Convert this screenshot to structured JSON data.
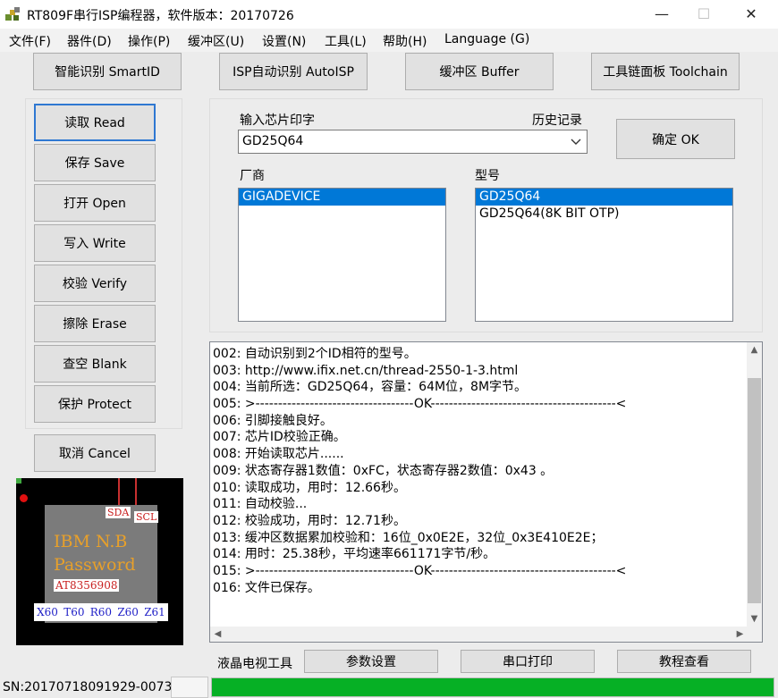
{
  "window": {
    "title": "RT809F串行ISP编程器，软件版本：20170726",
    "minimize_glyph": "—",
    "maximize_glyph": "☐",
    "close_glyph": "✕"
  },
  "menu": [
    "文件(F)",
    "器件(D)",
    "操作(P)",
    "缓冲区(U)",
    "设置(N)",
    "工具(L)",
    "帮助(H)",
    "Language (G)"
  ],
  "top_buttons": {
    "smartid": "智能识别 SmartID",
    "autoisp": "ISP自动识别 AutoISP",
    "buffer": "缓冲区 Buffer",
    "toolchain": "工具链面板 Toolchain"
  },
  "left_buttons": {
    "read": "读取 Read",
    "save": "保存 Save",
    "open": "打开 Open",
    "write": "写入 Write",
    "verify": "校验 Verify",
    "erase": "擦除 Erase",
    "blank": "查空 Blank",
    "protect": "保护 Protect",
    "cancel": "取消 Cancel"
  },
  "chip_search": {
    "input_label": "输入芯片印字",
    "history_label": "历史记录",
    "input_value": "GD25Q64",
    "confirm_label": "确定 OK"
  },
  "manufacturer": {
    "label": "厂商",
    "items": [
      "GIGADEVICE"
    ],
    "selected_index": 0
  },
  "model": {
    "label": "型号",
    "items": [
      "GD25Q64",
      "GD25Q64(8K BIT OTP)"
    ],
    "selected_index": 0
  },
  "log": [
    "002: 自动识别到2个ID相符的型号。",
    "003: http://www.ifix.net.cn/thread-2550-1-3.html",
    "004: 当前所选：GD25Q64，容量：64M位，8M字节。",
    "005: >-----------------------------------OK-----------------------------------------<",
    "006: 引脚接触良好。",
    "007: 芯片ID校验正确。",
    "008: 开始读取芯片......",
    "009: 状态寄存器1数值：0xFC，状态寄存器2数值：0x43 。",
    "010: 读取成功，用时：12.66秒。",
    "011: 自动校验...",
    "012: 校验成功，用时：12.71秒。",
    "013: 缓冲区数据累加校验和：16位_0x0E2E，32位_0x3E410E2E；",
    "014: 用时：25.38秒，平均速率661171字节/秒。",
    "015: >-----------------------------------OK-----------------------------------------<",
    "016: 文件已保存。"
  ],
  "chip_image": {
    "line1": "IBM  N.B",
    "line2": "Password",
    "code": "AT8356908",
    "sda": "SDA",
    "scl": "SCL",
    "pins": [
      "X60",
      "T60",
      "R60",
      "Z60",
      "Z61"
    ]
  },
  "bottom_bar": {
    "lcd_tools_label": "液晶电视工具",
    "params_button": "参数设置",
    "serial_print_button": "串口打印",
    "tutorial_button": "教程查看"
  },
  "status": {
    "serial": "SN:20170718091929-0073",
    "progress_percent": 100
  },
  "colors": {
    "accent": "#0078d7",
    "progress": "#06b025",
    "chip_text": "#e8a02a",
    "chip_pins": "#1f1fc7"
  },
  "icons": {
    "app": "app-icon",
    "combo": "chevron-down-icon",
    "scroll_up": "arrow-up-icon",
    "scroll_down": "arrow-down-icon",
    "scroll_left": "arrow-left-icon",
    "scroll_right": "arrow-right-icon"
  }
}
